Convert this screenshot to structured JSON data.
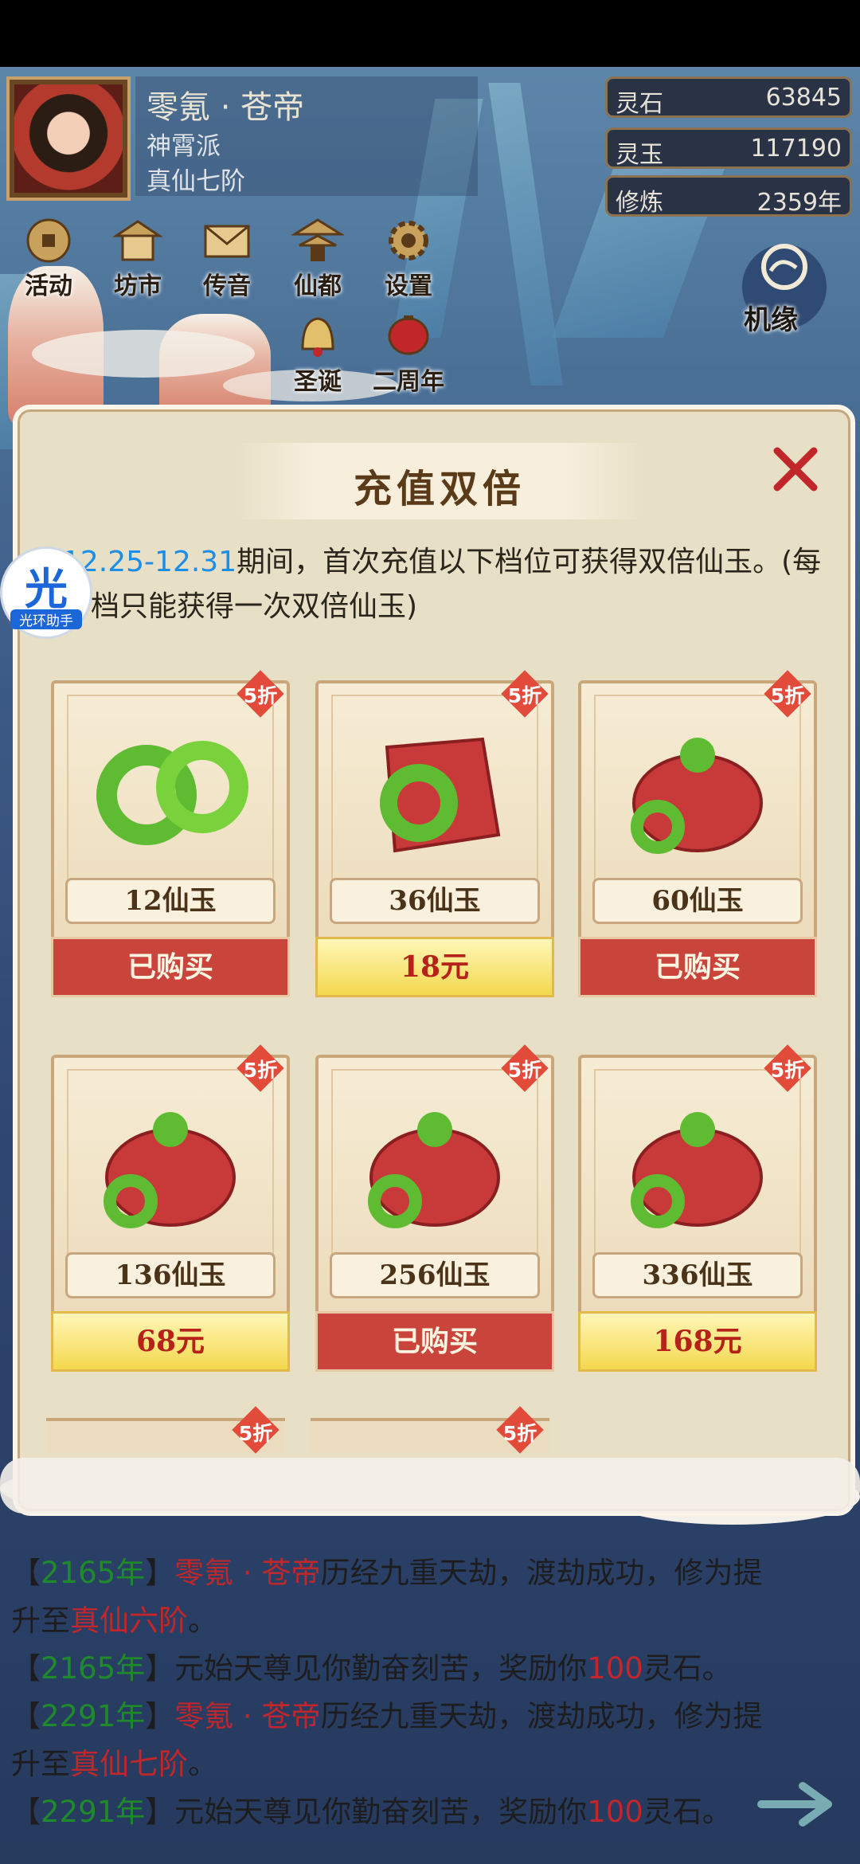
{
  "player": {
    "name": "零氪 · 苍帝",
    "sect": "神霄派",
    "rank": "真仙七阶"
  },
  "resources": [
    {
      "label": "灵石",
      "value": "63845"
    },
    {
      "label": "灵玉",
      "value": "117190"
    },
    {
      "label": "修炼",
      "value": "2359年"
    }
  ],
  "menu_row1": [
    {
      "label": "活动",
      "icon": "coin-icon"
    },
    {
      "label": "坊市",
      "icon": "shop-icon"
    },
    {
      "label": "传音",
      "icon": "mail-icon"
    },
    {
      "label": "仙都",
      "icon": "pavilion-icon"
    },
    {
      "label": "设置",
      "icon": "gear-icon"
    }
  ],
  "menu_row2": [
    {
      "label": "圣诞",
      "icon": "bell-icon"
    },
    {
      "label": "二周年",
      "icon": "lantern-icon"
    }
  ],
  "jiyuan_label": "机缘",
  "panel": {
    "title": "充值双倍",
    "desc_highlight": "12.25-12.31",
    "desc_rest": "期间，首次充值以下档位可获得双倍仙玉。(每一档只能获得一次双倍仙玉)",
    "discount": "5折",
    "cards": [
      {
        "amount": "12仙玉",
        "button": "已购买",
        "state": "bought"
      },
      {
        "amount": "36仙玉",
        "button": "18元",
        "state": "buy"
      },
      {
        "amount": "60仙玉",
        "button": "已购买",
        "state": "bought"
      },
      {
        "amount": "136仙玉",
        "button": "68元",
        "state": "buy"
      },
      {
        "amount": "256仙玉",
        "button": "已购买",
        "state": "bought"
      },
      {
        "amount": "336仙玉",
        "button": "168元",
        "state": "buy"
      }
    ]
  },
  "helper": {
    "glyph": "光",
    "text": "光环助手"
  },
  "log": [
    {
      "yr": "2165年",
      "name": "零氪 · 苍帝",
      "mid": "历经九重天劫，渡劫成功，修为提",
      "line2a": "升至",
      "rank": "真仙六阶",
      "end": "。"
    },
    {
      "yr": "2165年",
      "text": "元始天尊见你勤奋刻苦，奖励你",
      "num": "100",
      "tail": "灵石。"
    },
    {
      "yr": "2291年",
      "name": "零氪 · 苍帝",
      "mid": "历经九重天劫，渡劫成功，修为提",
      "line2a": "升至",
      "rank": "真仙七阶",
      "end": "。"
    },
    {
      "yr": "2291年",
      "text": "元始天尊见你勤奋刻苦，奖励你",
      "num": "100",
      "tail": "灵石。"
    }
  ],
  "brackets": {
    "open": "【",
    "close": "】"
  }
}
